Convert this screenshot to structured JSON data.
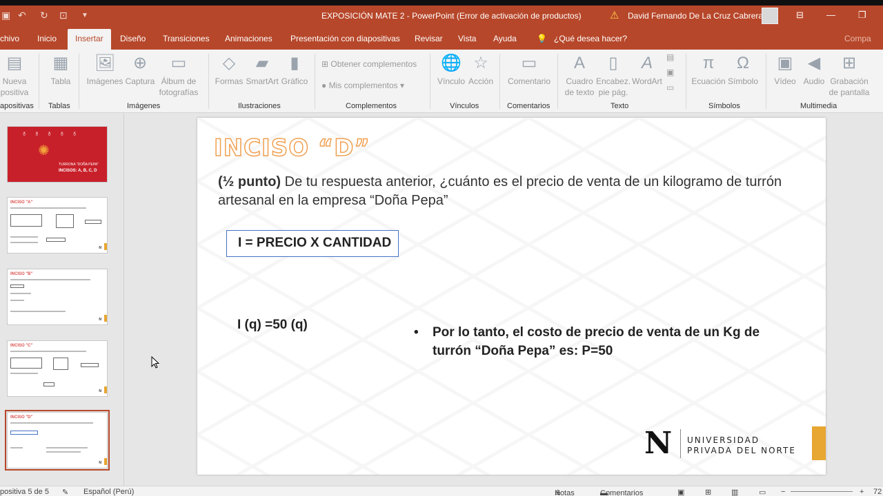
{
  "window": {
    "title": "EXPOSICIÓN MATE 2  -  PowerPoint (Error de activación de productos)",
    "user": "David Fernando De La Cruz Cabrera"
  },
  "tabs": [
    "chivo",
    "Inicio",
    "Insertar",
    "Diseño",
    "Transiciones",
    "Animaciones",
    "Presentación con diapositivas",
    "Revisar",
    "Vista",
    "Ayuda",
    "¿Qué desea hacer?",
    "Compa"
  ],
  "active_tab": "Insertar",
  "ribbon": {
    "groups": {
      "slides": "apositivas",
      "tables": "Tablas",
      "images": "Imágenes",
      "illustrations": "Ilustraciones",
      "addins": "Complementos",
      "links": "Vínculos",
      "comments": "Comentarios",
      "text": "Texto",
      "symbols": "Símbolos",
      "media": "Multimedia"
    },
    "buttons": {
      "new_slide": "Nueva\npositiva",
      "table": "Tabla",
      "images": "Imágenes",
      "screenshot": "Captura",
      "album": "Álbum de\nfotografías",
      "shapes": "Formas",
      "smartart": "SmartArt",
      "chart": "Gráfico",
      "get_addins": "Obtener complementos",
      "my_addins": "Mis complementos",
      "link": "Vínculo",
      "action": "Acción",
      "comment": "Comentario",
      "textbox": "Cuadro\nde texto",
      "header": "Encabez.\npie pág.",
      "wordart": "WordArt",
      "equation": "Ecuación",
      "symbol": "Símbolo",
      "video": "Vídeo",
      "audio": "Audio",
      "screen_rec": "Grabación\nde pantalla"
    }
  },
  "thumbnails": {
    "t1_line1": "TURRONA \"DOÑA PEPA\"",
    "t1_line2": "INCISOS: A, B, C, D",
    "t2_title": "INCISO \"A\"",
    "t3_title": "INCISO \"B\"",
    "t4_title": "INCISO \"C\"",
    "t5_title": "INCISO \"D\""
  },
  "slide": {
    "heading": "INCISO “D”",
    "question_bold": "(½ punto)",
    "question_rest": " De tu respuesta anterior, ¿cuánto es el precio de venta de un kilogramo  de turrón artesanal en la empresa “Doña Pepa”",
    "formula": "I = PRECIO X CANTIDAD",
    "equation": "I (q) =50 (q)",
    "bullet_dot": "•",
    "bullet_text": "Por lo tanto, el costo de precio de venta de un Kg de turrón “Doña Pepa”  es:      P=50",
    "logo_letter": "N",
    "logo_line1": "UNIVERSIDAD",
    "logo_line2": "PRIVADA DEL NORTE"
  },
  "statusbar": {
    "slide_counter": "positiva 5 de 5",
    "language": "Español (Perú)",
    "notes": "Notas",
    "comments": "Comentarios",
    "zoom": "72"
  },
  "colors": {
    "accent": "#b7472a",
    "slide_accent": "#e8a632",
    "heading_outline": "#f0a050",
    "formula_border": "#4472c4"
  }
}
